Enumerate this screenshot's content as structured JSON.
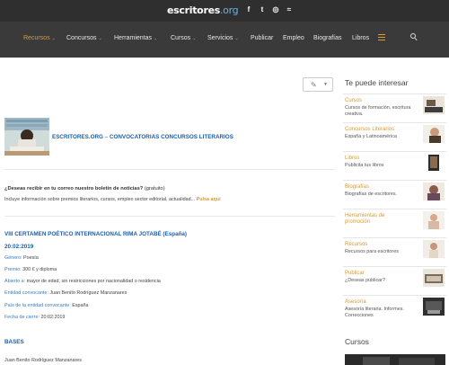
{
  "site": {
    "logo_main": "escritores",
    "logo_org": ".org"
  },
  "social": [
    {
      "icon": "facebook-icon",
      "glyph": "f"
    },
    {
      "icon": "twitter-icon",
      "glyph": "t"
    },
    {
      "icon": "instagram-icon",
      "glyph": "◎"
    },
    {
      "icon": "rss-icon",
      "glyph": "≈"
    }
  ],
  "nav": {
    "items": [
      {
        "label": "Recursos",
        "dropdown": true,
        "active": true
      },
      {
        "label": "Concursos",
        "dropdown": true
      },
      {
        "label": "Herramientas",
        "dropdown": true
      },
      {
        "label": "Cursos",
        "dropdown": true
      },
      {
        "label": "Servicios",
        "dropdown": true
      },
      {
        "label": "Publicar",
        "dropdown": false
      },
      {
        "label": "Empleo",
        "dropdown": false
      },
      {
        "label": "Biografías",
        "dropdown": false
      },
      {
        "label": "Libros",
        "dropdown": false
      }
    ]
  },
  "article": {
    "header_site": "ESCRITORES.ORG",
    "header_sep": " – ",
    "header_section": "CONVOCATORIAS CONCURSOS LITERARIOS",
    "newsletter_q": "¿Deseas recibir en tu correo nuestro boletín de noticias?",
    "newsletter_free": "(gratuito)",
    "newsletter_desc": "Incluye información sobre premios literarios, cursos, empleo sector editorial, actualidad...",
    "newsletter_cta": "Pulsa aquí",
    "title": "VIII CERTAMEN POÉTICO INTERNACIONAL RIMA JOTABÉ (España)",
    "date": "20:02:2019",
    "fields": [
      {
        "label": "Género:",
        "value": "Poesía"
      },
      {
        "label": "Premio:",
        "value": "300 € y diploma"
      },
      {
        "label": "Abierto a:",
        "value": "mayor de edad, sin restricciones por nacionalidad o residencia"
      },
      {
        "label": "Entidad convocante:",
        "value": "Juan Benito Rodríguez Manzanares"
      },
      {
        "label": "País de la entidad convocante:",
        "value": "España"
      },
      {
        "label": "Fecha de cierre:",
        "value": "20:02:2019"
      }
    ],
    "bases_heading": "BASES",
    "bases_by": "Juan Benito Rodríguez Manzanares"
  },
  "sidebar": {
    "title": "Te puede interesar",
    "items": [
      {
        "title": "Cursos",
        "desc": "Cursos de formación, escritura creativa."
      },
      {
        "title": "Concursos Literarios",
        "desc": "España y Latinoamérica"
      },
      {
        "title": "Libros",
        "desc": "Publicita tus libros"
      },
      {
        "title": "Biografías",
        "desc": "Biografías de escritores."
      },
      {
        "title": "Herramientas de promoción",
        "desc": ""
      },
      {
        "title": "Recursos",
        "desc": "Recursos para escritores"
      },
      {
        "title": "Publicar",
        "desc": "¿Deseas publicar?"
      },
      {
        "title": "Asesoría",
        "desc": "Asesoría literaria. Informes. Correcciones"
      }
    ],
    "cursos_heading": "Cursos"
  },
  "colors": {
    "accent": "#d79b35",
    "link": "#1a5fa8",
    "nav_bg": "#3a3a3a",
    "top_bg": "#2f2f2f"
  }
}
